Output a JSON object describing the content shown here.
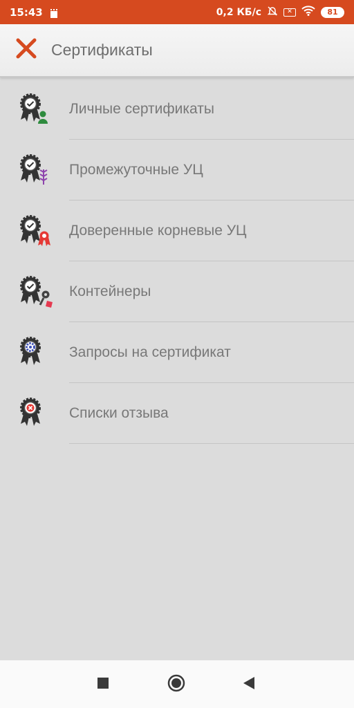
{
  "status_bar": {
    "time": "15:43",
    "network_speed": "0,2 КБ/с",
    "battery": "81",
    "icons": [
      "sim-icon",
      "mute-bell-icon",
      "box-x-icon",
      "wifi-icon",
      "battery-icon"
    ]
  },
  "header": {
    "title": "Сертификаты",
    "close_icon": "close-icon",
    "accent_color": "#d64a1f"
  },
  "list": {
    "items": [
      {
        "label": "Личные сертификаты",
        "icon": "personal-certificate-icon",
        "badge_color": "#2e8b3e"
      },
      {
        "label": "Промежуточные УЦ",
        "icon": "intermediate-ca-icon",
        "badge_color": "#8e44ad"
      },
      {
        "label": "Доверенные корневые УЦ",
        "icon": "trusted-root-ca-icon",
        "badge_color": "#e53935"
      },
      {
        "label": "Контейнеры",
        "icon": "container-key-icon",
        "badge_color": "#e53950"
      },
      {
        "label": "Запросы на сертификат",
        "icon": "certificate-request-icon",
        "badge_color": "#3f51b5"
      },
      {
        "label": "Списки отзыва",
        "icon": "revocation-list-icon",
        "badge_color": "#e53935"
      }
    ]
  },
  "nav_bar": {
    "buttons": [
      "recent-apps-icon",
      "home-icon",
      "back-icon"
    ]
  }
}
